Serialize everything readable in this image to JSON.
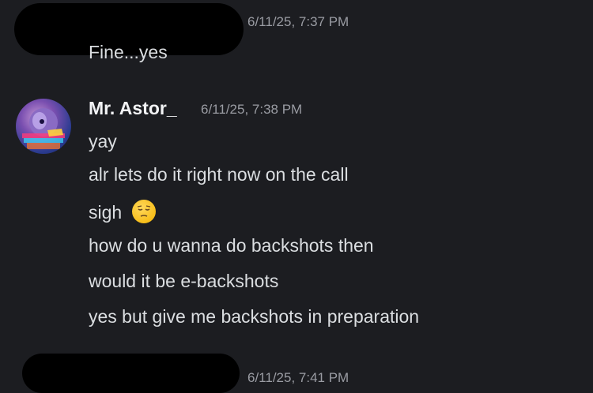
{
  "messages": [
    {
      "timestamp": "6/11/25, 7:37 PM",
      "lines": [
        "Fine...yes"
      ]
    },
    {
      "author": "Mr. Astor_",
      "timestamp": "6/11/25, 7:38 PM",
      "lines": [
        "yay",
        "alr lets do it right now on the call",
        "sigh",
        "how do u wanna do backshots then",
        "would it be e-backshots",
        "yes but give me backshots in preparation"
      ],
      "emoji": "pensive-face"
    },
    {
      "timestamp": "6/11/25, 7:41 PM",
      "lines": []
    }
  ]
}
